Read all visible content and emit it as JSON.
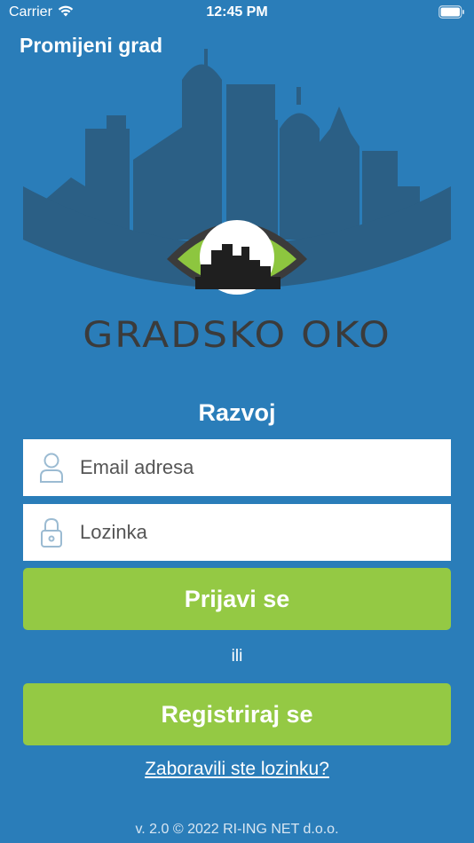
{
  "status_bar": {
    "carrier": "Carrier",
    "time": "12:45 PM",
    "wifi_icon": "wifi-icon",
    "battery_icon": "battery-icon"
  },
  "header": {
    "change_city": "Promijeni grad"
  },
  "logo": {
    "text": "GRADSKO OKO",
    "icon": "city-eye-logo"
  },
  "environment_label": "Razvoj",
  "form": {
    "email": {
      "placeholder": "Email adresa",
      "value": "",
      "icon": "user-icon"
    },
    "password": {
      "placeholder": "Lozinka",
      "value": "",
      "icon": "lock-icon"
    },
    "login_label": "Prijavi se",
    "or_label": "ili",
    "register_label": "Registriraj se",
    "forgot_label": "Zaboravili ste lozinku?"
  },
  "footer": "v. 2.0 © 2022 RI-ING NET d.o.o.",
  "colors": {
    "background": "#2a7db9",
    "button": "#94c944",
    "skyline": "#2b5f85",
    "eye_green": "#8dc63f",
    "logo_text": "#3b3b3b"
  }
}
